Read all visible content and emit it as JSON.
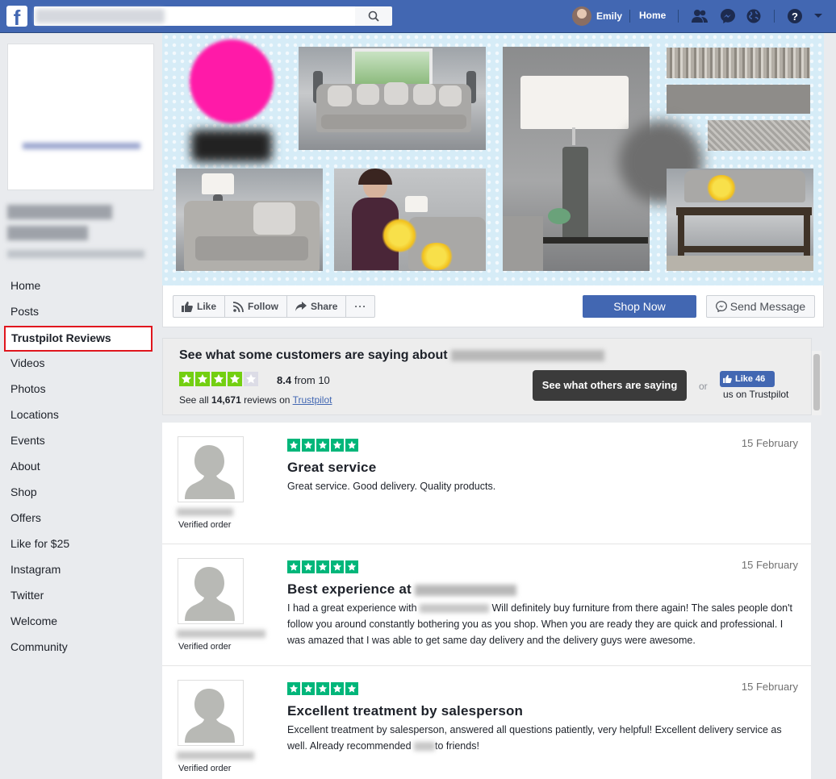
{
  "topbar": {
    "user_name": "Emily",
    "home_label": "Home",
    "search_placeholder": ""
  },
  "left_nav": {
    "items": [
      {
        "label": "Home"
      },
      {
        "label": "Posts"
      },
      {
        "label": "Trustpilot Reviews",
        "active": true
      },
      {
        "label": "Videos"
      },
      {
        "label": "Photos"
      },
      {
        "label": "Locations"
      },
      {
        "label": "Events"
      },
      {
        "label": "About"
      },
      {
        "label": "Shop"
      },
      {
        "label": "Offers"
      },
      {
        "label": "Like for $25"
      },
      {
        "label": "Instagram"
      },
      {
        "label": "Twitter"
      },
      {
        "label": "Welcome"
      },
      {
        "label": "Community"
      }
    ]
  },
  "actions": {
    "like": "Like",
    "follow": "Follow",
    "share": "Share",
    "more": "···",
    "shop_now": "Shop Now",
    "send_message": "Send Message"
  },
  "trustpilot": {
    "heading": "See what some customers are saying about",
    "stars_filled": 4,
    "stars_total": 5,
    "score": "8.4",
    "score_suffix": "from 10",
    "see_all_prefix": "See all",
    "review_count": "14,671",
    "reviews_on": "reviews on",
    "link_label": "Trustpilot",
    "cta": "See what others are saying",
    "or": "or",
    "like_label": "Like 46",
    "like_sub": "us on Trustpilot",
    "star_color": "#73cf11",
    "star_empty_color": "#dcdce6"
  },
  "reviews": [
    {
      "stars": 5,
      "date": "15 February",
      "title": "Great service",
      "body": "Great service. Good delivery. Quality products.",
      "verified": "Verified order"
    },
    {
      "stars": 5,
      "date": "15 February",
      "title": "Best experience at",
      "body_before": "I had a great experience with",
      "body_after": "Will definitely buy furniture from there again! The sales people don't follow you around constantly bothering you as you shop. When you are ready they are quick and professional. I was amazed that I was able to get same day delivery and the delivery guys were awesome.",
      "verified": "Verified order"
    },
    {
      "stars": 5,
      "date": "15 February",
      "title": "Excellent treatment by salesperson",
      "body_before": "Excellent treatment by salesperson, answered all questions patiently, very helpful! Excellent delivery service as well. Already recommended",
      "body_after": "to friends!",
      "verified": "Verified order"
    }
  ],
  "colors": {
    "fb_blue": "#4267b2",
    "trustpilot_green": "#00b67a",
    "active_outline": "#e0161e"
  }
}
